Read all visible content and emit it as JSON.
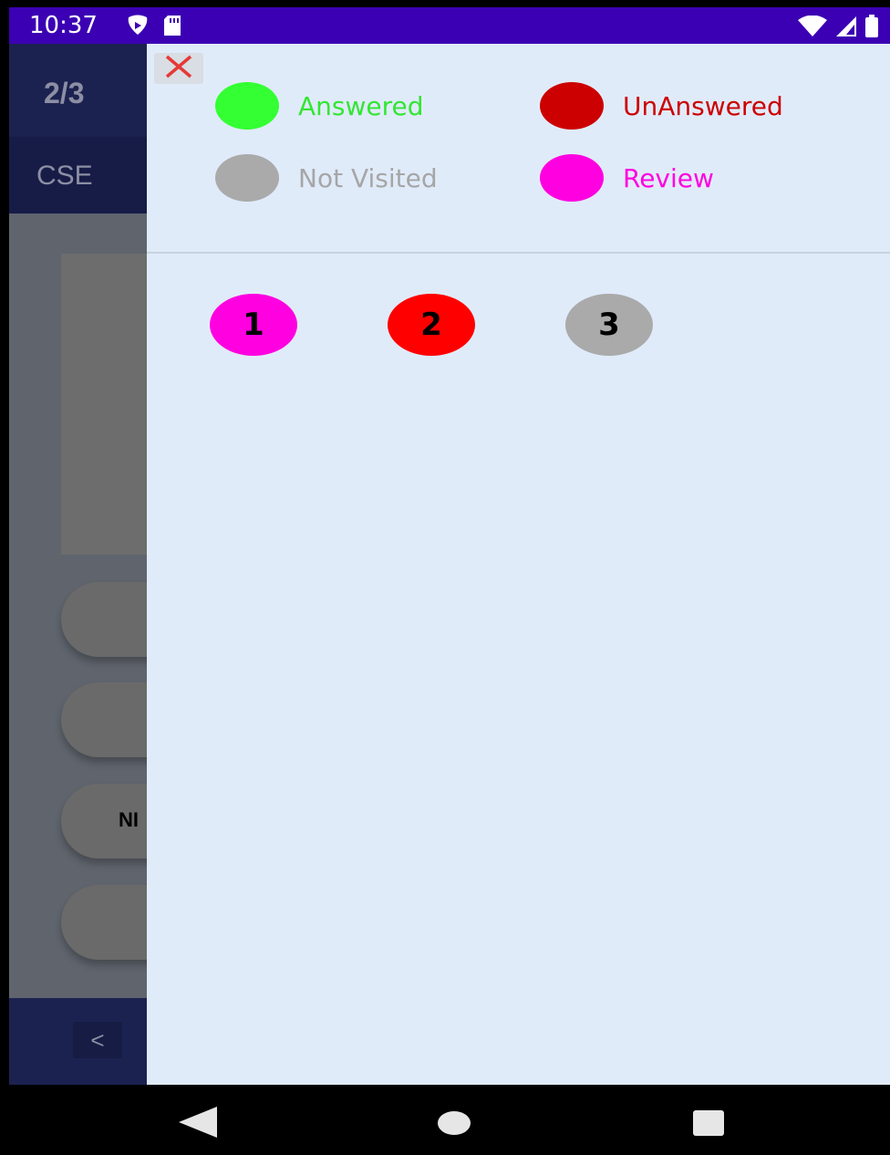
{
  "status_bar": {
    "time": "10:37",
    "icons": [
      "play-protect-icon",
      "sd-card-icon",
      "wifi-icon",
      "signal-icon",
      "battery-icon"
    ]
  },
  "background_app": {
    "question_counter": "2/3",
    "subject": "CSE",
    "options": [
      "",
      "",
      "NI",
      ""
    ],
    "prev_label": "<"
  },
  "drawer": {
    "close_icon": "close-icon",
    "legend": [
      {
        "label": "Answered",
        "color": "#33ff33",
        "text_color": "#33e633"
      },
      {
        "label": "UnAnswered",
        "color": "#cc0000",
        "text_color": "#cc0000"
      },
      {
        "label": "Not Visited",
        "color": "#aaaaaa",
        "text_color": "#a6a6a6"
      },
      {
        "label": "Review",
        "color": "#ff00e0",
        "text_color": "#ff00e0"
      }
    ],
    "questions": [
      {
        "number": "1",
        "color": "#ff00e0"
      },
      {
        "number": "2",
        "color": "#ff0000"
      },
      {
        "number": "3",
        "color": "#aaaaaa"
      }
    ]
  },
  "nav_bar": {
    "icons": [
      "back-icon",
      "home-icon",
      "recent-apps-icon"
    ]
  }
}
